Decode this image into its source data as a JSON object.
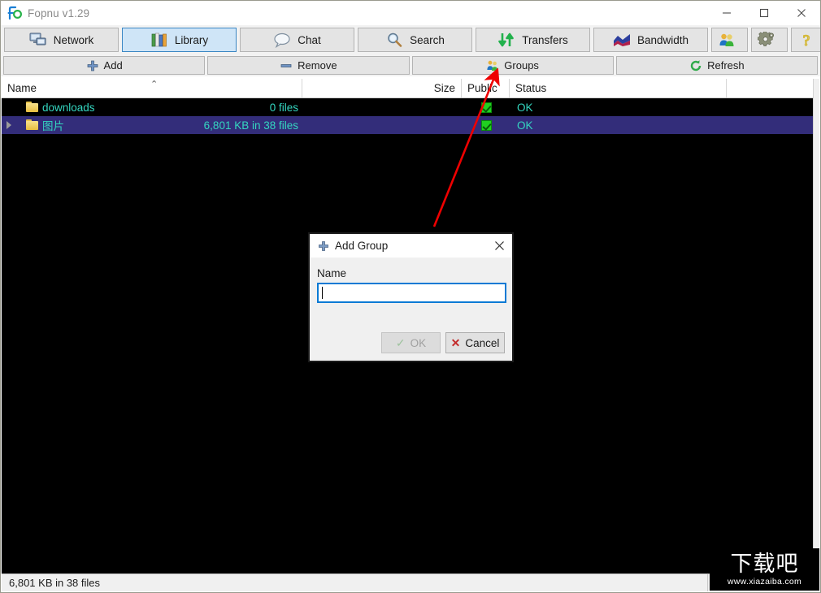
{
  "window": {
    "title": "Fopnu v1.29",
    "logo_icon": "fopnu-logo-icon",
    "minimize_icon": "minimize-icon",
    "maximize_icon": "maximize-icon",
    "close_icon": "close-icon"
  },
  "tabs": [
    {
      "label": "Network",
      "icon": "network-computer-icon",
      "active": false
    },
    {
      "label": "Library",
      "icon": "books-icon",
      "active": true
    },
    {
      "label": "Chat",
      "icon": "speech-bubble-icon",
      "active": false
    },
    {
      "label": "Search",
      "icon": "magnifier-icon",
      "active": false
    },
    {
      "label": "Transfers",
      "icon": "up-down-arrows-icon",
      "active": false
    },
    {
      "label": "Bandwidth",
      "icon": "bandwidth-graph-icon",
      "active": false
    },
    {
      "label": "",
      "icon": "users-icon",
      "active": false
    },
    {
      "label": "",
      "icon": "gear-icon",
      "active": false
    },
    {
      "label": "",
      "icon": "question-mark-icon",
      "active": false
    }
  ],
  "actions": [
    {
      "label": "Add",
      "icon": "plus-icon"
    },
    {
      "label": "Remove",
      "icon": "minus-icon"
    },
    {
      "label": "Groups",
      "icon": "groups-icon"
    },
    {
      "label": "Refresh",
      "icon": "refresh-icon"
    }
  ],
  "list": {
    "columns": [
      {
        "label": "Name",
        "align": "left"
      },
      {
        "label": "Size",
        "align": "right"
      },
      {
        "label": "Public",
        "align": "left"
      },
      {
        "label": "Status",
        "align": "left"
      }
    ],
    "sort_column": "Name",
    "sort_direction": "ascending",
    "rows": [
      {
        "name": "downloads",
        "size": "0 files",
        "public": true,
        "status": "OK",
        "selected": false,
        "expandable": false
      },
      {
        "name": "图片",
        "size": "6,801 KB in 38 files",
        "public": true,
        "status": "OK",
        "selected": true,
        "expandable": true
      }
    ]
  },
  "statusbar": {
    "text": "6,801 KB in 38 files"
  },
  "dialog": {
    "title": "Add Group",
    "title_icon": "plus-icon",
    "close_icon": "close-icon",
    "name_label": "Name",
    "name_value": "",
    "name_placeholder": "",
    "ok_label": "OK",
    "ok_enabled": false,
    "cancel_label": "Cancel"
  },
  "annotation": {
    "arrow_color": "#ee0000",
    "points_to": "Groups"
  },
  "watermark": {
    "cn_text": "下载吧",
    "url_text": "www.xiazaiba.com"
  },
  "colors": {
    "accent": "#0a7ad4",
    "list_text": "#34d6c0",
    "list_bg": "#000000",
    "selected_row": "#332d7a",
    "ok_green": "#20d020"
  }
}
